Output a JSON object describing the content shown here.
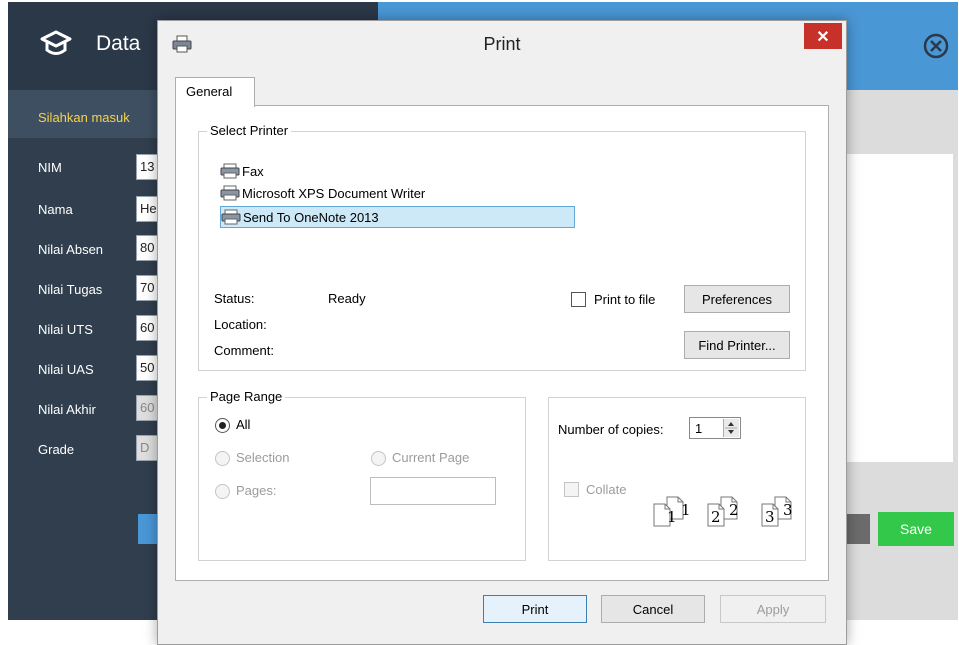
{
  "app": {
    "title": "Data",
    "subtitle": "Silahkan masuk",
    "fields": [
      {
        "label": "NIM",
        "value": "13"
      },
      {
        "label": "Nama",
        "value": "He"
      },
      {
        "label": "Nilai Absen",
        "value": "80"
      },
      {
        "label": "Nilai Tugas",
        "value": "70"
      },
      {
        "label": "Nilai UTS",
        "value": "60"
      },
      {
        "label": "Nilai UAS",
        "value": "50"
      },
      {
        "label": "Nilai Akhir",
        "value": "60"
      },
      {
        "label": "Grade",
        "value": "D"
      }
    ],
    "save_label": "Save",
    "colors": {
      "header_dark": "#2b3848",
      "header_blue": "#4a97d6",
      "subtitle": "#f5d24c",
      "save": "#34c84a"
    }
  },
  "dialog": {
    "title": "Print",
    "close_glyph": "✕",
    "tab_label": "General",
    "select_printer": {
      "legend": "Select Printer",
      "printers": [
        {
          "name": "Fax",
          "selected": false
        },
        {
          "name": "Microsoft XPS Document Writer",
          "selected": false
        },
        {
          "name": "Send To OneNote 2013",
          "selected": true
        }
      ],
      "status_label": "Status:",
      "status_value": "Ready",
      "location_label": "Location:",
      "comment_label": "Comment:",
      "print_to_file_label": "Print to file",
      "preferences_label": "Preferences",
      "find_printer_label": "Find Printer..."
    },
    "page_range": {
      "legend": "Page Range",
      "all_label": "All",
      "selection_label": "Selection",
      "current_page_label": "Current Page",
      "pages_label": "Pages:",
      "pages_value": ""
    },
    "copies": {
      "label": "Number of copies:",
      "value": "1",
      "collate_label": "Collate",
      "collate_numbers": [
        "1",
        "1",
        "2",
        "2",
        "3",
        "3"
      ]
    },
    "buttons": {
      "print": "Print",
      "cancel": "Cancel",
      "apply": "Apply"
    }
  }
}
